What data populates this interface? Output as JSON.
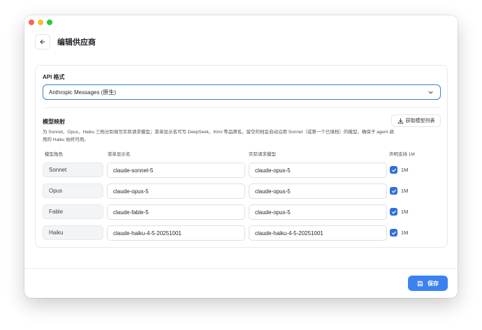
{
  "header": {
    "title": "编辑供应商"
  },
  "api_format": {
    "label": "API 格式",
    "selected": "Anthropic Messages (原生)"
  },
  "model_mapping": {
    "label": "模型映射",
    "fetch_button": "获取模型列表",
    "description_line1": "为 Sonnet、Opus、Haiku 三档分别填写实际请求模型；菜单显示名可写 DeepSeek、Kimi 等品牌名。留空的档会自动沿用 Sonnet（或第一个已填档）的模型，确保子 agent 调",
    "description_line2": "用的 Haiku 始终可用。",
    "columns": {
      "role": "模型角色",
      "display_name": "菜单显示名",
      "actual_model": "实际请求模型",
      "supports_1m": "声明支持 1M"
    },
    "rows": [
      {
        "role": "Sonnet",
        "display_name": "claude-sonnet-5",
        "actual_model": "claude-opus-5",
        "tag": "1M",
        "checked": true
      },
      {
        "role": "Opus",
        "display_name": "claude-opus-5",
        "actual_model": "claude-opus-5",
        "tag": "1M",
        "checked": true
      },
      {
        "role": "Fable",
        "display_name": "claude-fable-5",
        "actual_model": "claude-opus-5",
        "tag": "1M",
        "checked": true
      },
      {
        "role": "Haiku",
        "display_name": "claude-haiku-4-5-20251001",
        "actual_model": "claude-haiku-4-5-20251001",
        "tag": "1M",
        "checked": true
      }
    ]
  },
  "footer": {
    "save_label": "保存"
  },
  "colors": {
    "accent": "#3b82f0",
    "checkbox": "#2f6fde",
    "select_border": "#3b82c4"
  },
  "icons": [
    "arrow-left-icon",
    "chevron-down-icon",
    "download-icon",
    "check-icon",
    "save-icon"
  ]
}
